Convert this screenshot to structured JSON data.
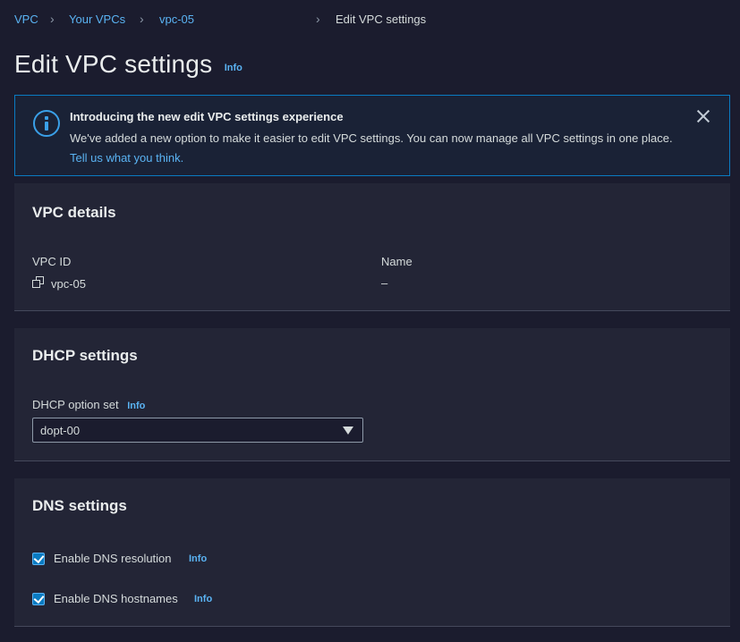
{
  "breadcrumb": {
    "items": [
      "VPC",
      "Your VPCs",
      "vpc-05"
    ],
    "current": "Edit VPC settings"
  },
  "page": {
    "title": "Edit VPC settings",
    "info_label": "Info"
  },
  "flash": {
    "title": "Introducing the new edit VPC settings experience",
    "body": "We've added a new option to make it easier to edit VPC settings. You can now manage all VPC settings in one place.",
    "link": "Tell us what you think."
  },
  "vpc_details": {
    "title": "VPC details",
    "vpc_id_label": "VPC ID",
    "vpc_id_value": "vpc-05",
    "name_label": "Name",
    "name_value": "–"
  },
  "dhcp": {
    "title": "DHCP settings",
    "option_set_label": "DHCP option set",
    "info_label": "Info",
    "selected": "dopt-00"
  },
  "dns": {
    "title": "DNS settings",
    "resolution_label": "Enable DNS resolution",
    "resolution_checked": true,
    "hostnames_label": "Enable DNS hostnames",
    "hostnames_checked": true,
    "info_label": "Info"
  },
  "colors": {
    "background": "#1b1c2e",
    "panel": "#232536",
    "link": "#5ab3f3",
    "accent": "#0a7bc2"
  }
}
